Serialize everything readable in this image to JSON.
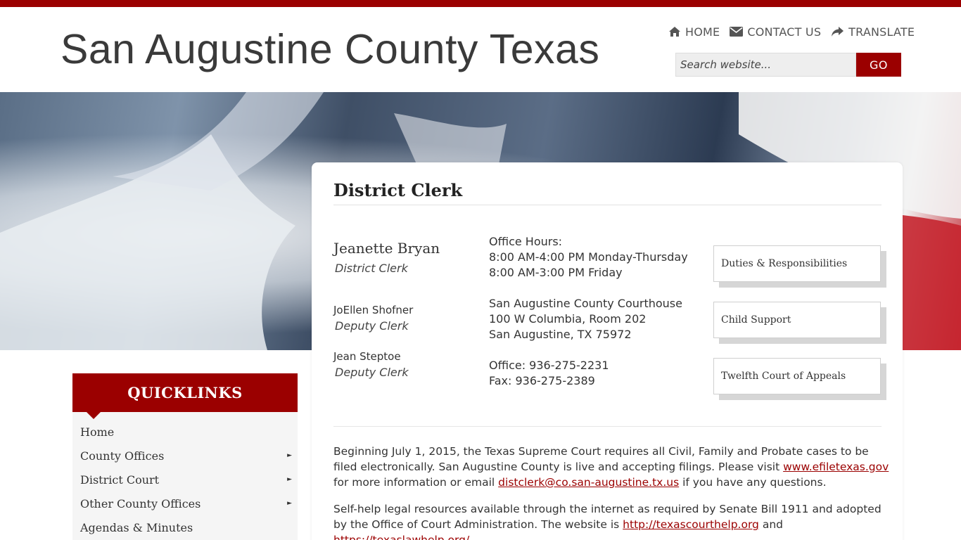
{
  "header": {
    "site_title": "San Augustine County Texas",
    "nav": [
      {
        "label": "HOME",
        "icon": "home-icon"
      },
      {
        "label": "CONTACT US",
        "icon": "envelope-icon"
      },
      {
        "label": "TRANSLATE",
        "icon": "share-arrow-icon"
      }
    ],
    "search": {
      "placeholder": "Search website...",
      "button": "GO"
    }
  },
  "colors": {
    "brand": "#9b0000"
  },
  "main": {
    "page_title": "District Clerk",
    "staff": [
      {
        "name": "Jeanette Bryan",
        "role": "District Clerk"
      },
      {
        "name": "JoEllen Shofner",
        "role": "Deputy Clerk"
      },
      {
        "name": "Jean Steptoe",
        "role": "Deputy Clerk"
      }
    ],
    "office_hours": [
      "Office Hours:",
      "8:00 AM-4:00 PM Monday-Thursday",
      "8:00 AM-3:00 PM Friday"
    ],
    "address": [
      "San Augustine County Courthouse",
      "100 W Columbia, Room 202",
      "San Augustine, TX 75972"
    ],
    "phones": [
      "Office: 936-275-2231",
      "Fax: 936-275-2389"
    ],
    "side_buttons": [
      "Duties & Responsibilities",
      "Child Support",
      "Twelfth Court of Appeals"
    ],
    "para1": {
      "text1": "Beginning July 1, 2015, the Texas Supreme Court requires all Civil, Family and Probate cases to be filed electronically. San Augustine County is live and accepting filings. Please visit ",
      "link1": "www.efiletexas.gov",
      "text2": " for more information or email ",
      "link2": "distclerk@co.san-augustine.tx.us",
      "text3": " if you have any questions."
    },
    "para2": {
      "text1": "Self-help legal resources available through the internet as required by Senate Bill 1911 and adopted by the Office of Court Administration. The website is ",
      "link1": "http://texascourthelp.org",
      "text2": " and ",
      "link2": "https://texaslawhelp.org/"
    }
  },
  "quicklinks": {
    "title": "QUICKLINKS",
    "items": [
      {
        "label": "Home",
        "has_submenu": false
      },
      {
        "label": "County Offices",
        "has_submenu": true
      },
      {
        "label": "District Court",
        "has_submenu": true
      },
      {
        "label": "Other County Offices",
        "has_submenu": true
      },
      {
        "label": "Agendas & Minutes",
        "has_submenu": false
      }
    ],
    "caret": "►"
  }
}
